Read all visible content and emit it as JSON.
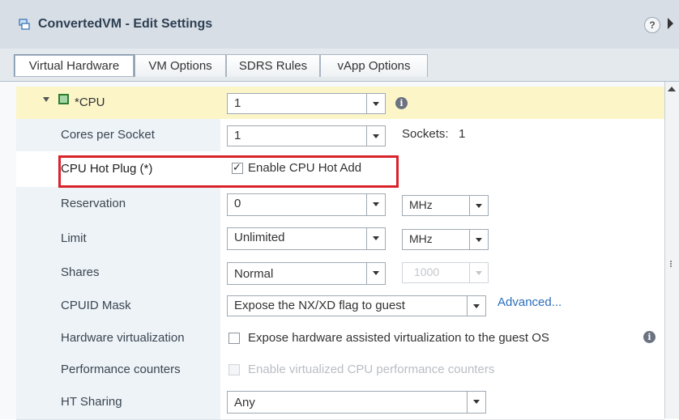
{
  "window": {
    "title": "ConvertedVM - Edit Settings",
    "help_label": "?"
  },
  "tabs": [
    {
      "label": "Virtual Hardware",
      "active": true
    },
    {
      "label": "VM Options",
      "active": false
    },
    {
      "label": "SDRS Rules",
      "active": false
    },
    {
      "label": "vApp Options",
      "active": false
    }
  ],
  "rows": {
    "cpu": {
      "label": "*CPU",
      "value": "1",
      "info": "i"
    },
    "cores": {
      "label": "Cores per Socket",
      "value": "1",
      "sockets_label": "Sockets:",
      "sockets_value": "1"
    },
    "hotplug": {
      "label": "CPU Hot Plug (*)",
      "checkbox_label": "Enable CPU Hot Add",
      "checked": true
    },
    "reservation": {
      "label": "Reservation",
      "value": "0",
      "unit": "MHz"
    },
    "limit": {
      "label": "Limit",
      "value": "Unlimited",
      "unit": "MHz"
    },
    "shares": {
      "label": "Shares",
      "value": "Normal",
      "amount": "1000"
    },
    "cpuid": {
      "label": "CPUID Mask",
      "value": "Expose the NX/XD flag to guest",
      "link": "Advanced..."
    },
    "hwvirt": {
      "label": "Hardware virtualization",
      "checkbox_label": "Expose hardware assisted virtualization to the guest OS",
      "checked": false,
      "info": "i"
    },
    "perf": {
      "label": "Performance counters",
      "checkbox_label": "Enable virtualized CPU performance counters",
      "checked": false
    },
    "ht": {
      "label": "HT Sharing",
      "value": "Any"
    }
  },
  "colors": {
    "highlight_box": "#d8232a",
    "title_bar": "#d7dee6",
    "cpu_row": "#fbf5c8",
    "link": "#2a6ebb"
  }
}
